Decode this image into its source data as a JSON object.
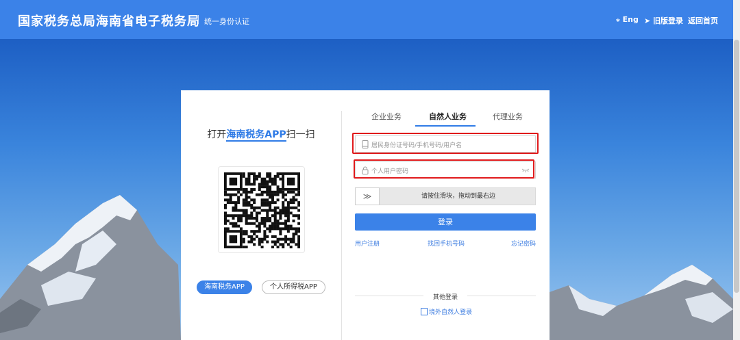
{
  "header": {
    "title": "国家税务总局海南省电子税务局",
    "subtitle": "统一身份认证",
    "links": [
      {
        "label": "Eng",
        "icon": "language-icon"
      },
      {
        "label": "旧版登录",
        "icon": "send-icon"
      },
      {
        "label": "返回首页"
      }
    ]
  },
  "qr_panel": {
    "title_prefix": "打开",
    "title_highlight": "海南税务APP",
    "title_suffix": "扫一扫",
    "buttons": [
      "海南税务APP",
      "个人所得税APP"
    ]
  },
  "form": {
    "tabs": [
      "企业业务",
      "自然人业务",
      "代理业务"
    ],
    "active_tab": "自然人业务",
    "username_placeholder": "居民身份证号码/手机号码/用户名",
    "password_placeholder": "个人用户密码",
    "slider_handle": "≫",
    "slider_text": "请按住滑块，拖动到最右边",
    "login_button": "登录",
    "links": [
      "用户注册",
      "找回手机号码",
      "忘记密码"
    ],
    "other_login_label": "其他登录",
    "overseas_login": "境外自然人登录"
  },
  "colors": {
    "header_bg": "#3b82e8",
    "accent": "#2f7be6",
    "highlight_border": "#e0191b"
  }
}
